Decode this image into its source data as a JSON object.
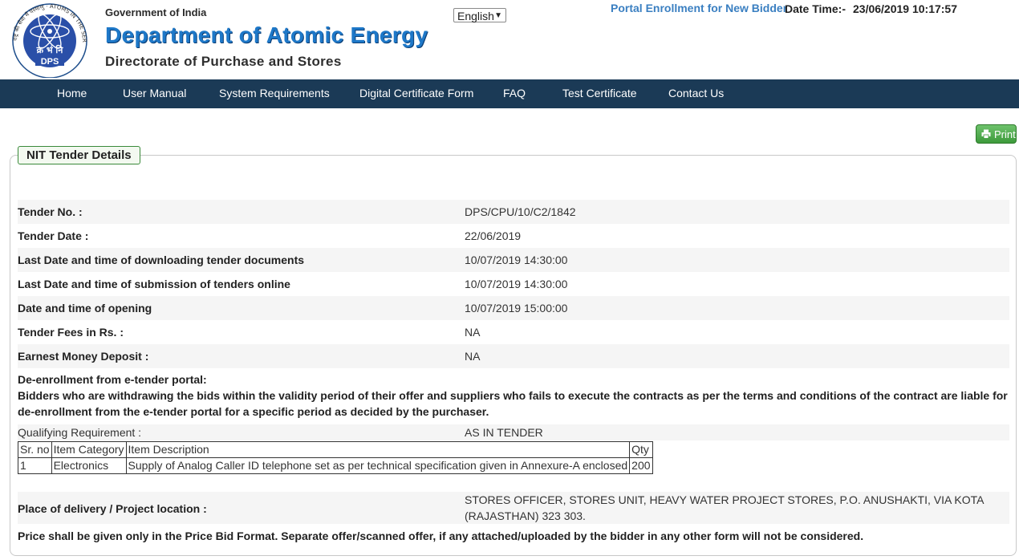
{
  "header": {
    "emblem": {
      "ring_text": "राष्ट्र की सेवा में परमाणु · ATOMS IN THE SERVICE OF THE NATION",
      "hindi_initials": "क्र भं नि",
      "initials": "DPS"
    },
    "gov_label": "Government of India",
    "dept_title": "Department of Atomic Energy",
    "directorate": "Directorate of Purchase and Stores",
    "language": "English",
    "portal_link": "Portal Enrollment for New Bidder",
    "date_label": "Date Time:-",
    "date_value": "23/06/2019 10:17:57"
  },
  "nav": [
    "Home",
    "User Manual",
    "System Requirements",
    "Digital Certificate Form",
    "FAQ",
    "Test Certificate",
    "Contact Us"
  ],
  "print_label": "Print",
  "panel": {
    "title": "NIT Tender Details",
    "details": [
      {
        "label": "Tender No. :",
        "value": "DPS/CPU/10/C2/1842"
      },
      {
        "label": "Tender Date :",
        "value": "22/06/2019"
      },
      {
        "label": "Last Date and time of downloading tender documents",
        "value": "10/07/2019 14:30:00"
      },
      {
        "label": "Last Date and time of submission of tenders online",
        "value": "10/07/2019 14:30:00"
      },
      {
        "label": "Date and time of opening",
        "value": "10/07/2019 15:00:00"
      },
      {
        "label": "Tender Fees in Rs. :",
        "value": "NA"
      },
      {
        "label": "Earnest Money Deposit :",
        "value": "NA"
      }
    ],
    "deenroll_heading": "De-enrollment from e-tender portal:",
    "deenroll_text": "Bidders who are withdrawing the bids within the validity period of their offer and suppliers who fails to execute the contracts as per the terms and conditions of the contract are liable for de-enrollment from the e-tender portal for a specific period as decided by the purchaser.",
    "qualifying_label": "Qualifying Requirement :",
    "qualifying_value": "AS IN TENDER",
    "items_table": {
      "headers": [
        "Sr. no",
        "Item Category",
        "Item Description",
        "Qty"
      ],
      "rows": [
        [
          "1",
          "Electronics",
          "Supply of Analog Caller ID telephone set as per technical specification given in Annexure-A enclosed",
          "200"
        ]
      ]
    },
    "place_label": "Place of delivery / Project location :",
    "place_value": "STORES OFFICER, STORES UNIT, HEAVY WATER PROJECT STORES, P.O. ANUSHAKTI, VIA KOTA (RAJASTHAN) 323 303.",
    "price_note": "Price shall be given only in the Price Bid Format. Separate offer/scanned offer, if any attached/uploaded by the bidder in any other form will not be considered."
  },
  "colors": {
    "nav_bg": "#1b3a56",
    "dept_blue": "#1e78c8",
    "link_blue": "#3a7fc1",
    "print_green": "#4caf50",
    "legend_border": "#3a8a3a"
  }
}
